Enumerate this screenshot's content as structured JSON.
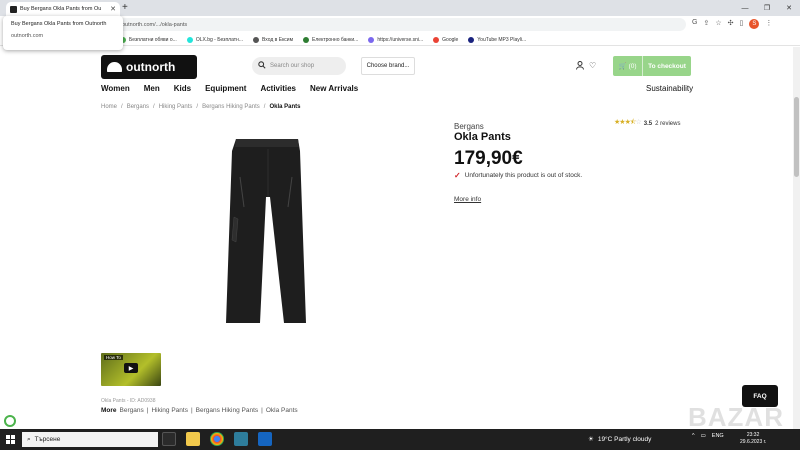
{
  "browser": {
    "tab_title": "Buy Bergans Okla Pants from Ou",
    "new_tab": "+",
    "url": "outnorth.com/.../okla-pants",
    "win_min": "—",
    "win_max": "❐",
    "win_close": "✕",
    "profile_initial": "S",
    "bookmarks": [
      {
        "label": "Безплатни обяви о...",
        "color": "#4caf50"
      },
      {
        "label": "OLX.bg - Безплатн...",
        "color": "#23e5db"
      },
      {
        "label": "Вход в Ексим",
        "color": "#555555"
      },
      {
        "label": "Електронно банки...",
        "color": "#2e7d32"
      },
      {
        "label": "https://universe.sni...",
        "color": "#7b68ee"
      },
      {
        "label": "Google",
        "color": "#ea4335"
      },
      {
        "label": "YouTube MP3 Playli...",
        "color": "#1a237e"
      }
    ],
    "tooltip_title": "Buy Bergans Okla Pants from Outnorth",
    "tooltip_domain": "outnorth.com"
  },
  "header": {
    "logo_text": "outnorth",
    "search_placeholder": "Search our shop",
    "brand_select": "Choose brand...",
    "cart_count": "(0)",
    "checkout_label": "To checkout"
  },
  "nav": {
    "items": [
      "Women",
      "Men",
      "Kids",
      "Equipment",
      "Activities",
      "New Arrivals"
    ],
    "sustainability": "Sustainability"
  },
  "breadcrumb": [
    "Home",
    "Bergans",
    "Hiking Pants",
    "Bergans Hiking Pants",
    "Okla Pants"
  ],
  "product": {
    "brand": "Bergans",
    "name": "Okla Pants",
    "price": "179,90€",
    "rating_value": 3.5,
    "rating_text": "3.5",
    "reviews": "2 reviews",
    "stock_text": "Unfortunately this product is out of stock.",
    "more_info": "More info",
    "video_label": "How To",
    "sku_text": "Okla Pants - ID: AD0938",
    "more_label": "More",
    "more_links": [
      "Bergans",
      "Hiking Pants",
      "Bergans Hiking Pants",
      "Okla Pants"
    ]
  },
  "faq_label": "FAQ",
  "taskbar": {
    "search_placeholder": "Търсене",
    "weather": "19°C  Partly cloudy",
    "lang": "ENG",
    "time": "23:32",
    "date": "29.6.2023 г."
  },
  "watermark": "BAZAR",
  "colors": {
    "cart_green": "#98d58a",
    "star_gold": "#d8b026",
    "error_red": "#d0262a"
  }
}
